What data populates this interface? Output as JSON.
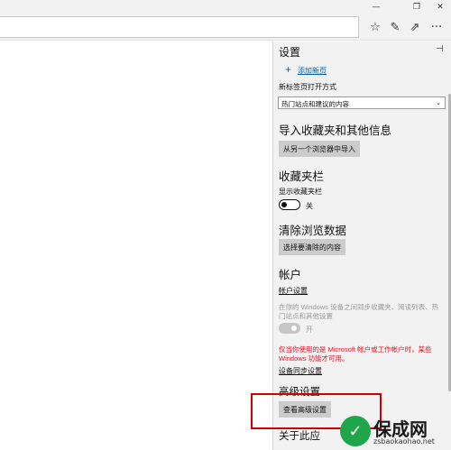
{
  "window": {
    "min_glyph": "—",
    "max_glyph": "❐",
    "close_glyph": "✕"
  },
  "toolbar": {
    "icons": [
      "favorites-icon",
      "notes-icon",
      "share-icon",
      "more-icon"
    ],
    "favorites_glyph": "☆",
    "notes_glyph": "✎",
    "share_glyph": "⇗",
    "more_glyph": "···"
  },
  "settings": {
    "title": "设置",
    "pin_glyph": "⊣",
    "new_tab": {
      "plus_glyph": "+",
      "add_link": "添加新页",
      "open_label": "新标签页打开方式",
      "open_value": "热门站点和建议的内容",
      "arrow": "⌄"
    },
    "import": {
      "heading": "导入收藏夹和其他信息",
      "button": "从另一个浏览器中导入"
    },
    "favorites_bar": {
      "heading": "收藏夹栏",
      "show_label": "显示收藏夹栏",
      "toggle_state": "关"
    },
    "clear_data": {
      "heading": "清除浏览数据",
      "button": "选择要清除的内容"
    },
    "account": {
      "heading": "帐户",
      "account_link": "帐户设置",
      "sync_desc_1": "在你的 Windows 设备之间同步收藏夹、阅读列表、热",
      "sync_desc_2": "门站点和其他设置",
      "sync_state": "开",
      "warning_1": "仅当你使用的是 Microsoft 帐户或工作帐户时，某些",
      "warning_2": "Windows 功能才可用。",
      "sync_link": "设备同步设置"
    },
    "advanced": {
      "heading": "高级设置",
      "button": "查看高级设置"
    },
    "about": {
      "heading": "关于此应"
    }
  },
  "watermark": {
    "badge": "✓",
    "text": "保成网",
    "url": "zsbaokaohao.net"
  },
  "colors": {
    "link": "#0063b1",
    "warning": "#e81123",
    "highlight": "#d40000",
    "watermark": "#1fa64a"
  }
}
